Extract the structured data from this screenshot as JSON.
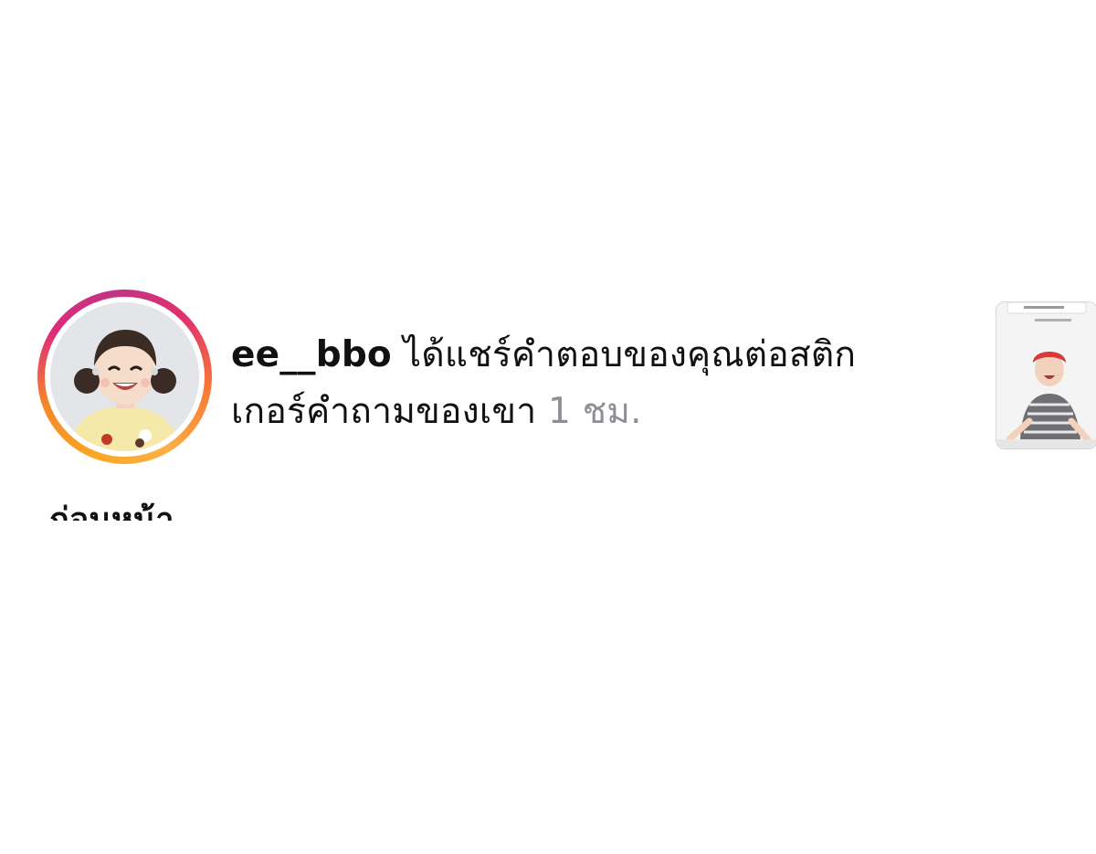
{
  "notification": {
    "username": "ee__bbo",
    "message_line1": "ได้แชร์คำตอบของคุณต่อสติก",
    "message_line2": "เกอร์คำถามของเขา",
    "timestamp": "1 ชม."
  },
  "avatar": {
    "icon": "profile-photo",
    "ring_colors": [
      "#f9a825",
      "#f58529",
      "#dd2a7b",
      "#c13584"
    ]
  },
  "story_thumbnail": {
    "icon": "story-preview-image"
  },
  "section": {
    "heading_partial": "ก่อนหน้านี้"
  },
  "colors": {
    "text": "#111111",
    "timestamp": "#8e8e95",
    "background": "#ffffff"
  }
}
